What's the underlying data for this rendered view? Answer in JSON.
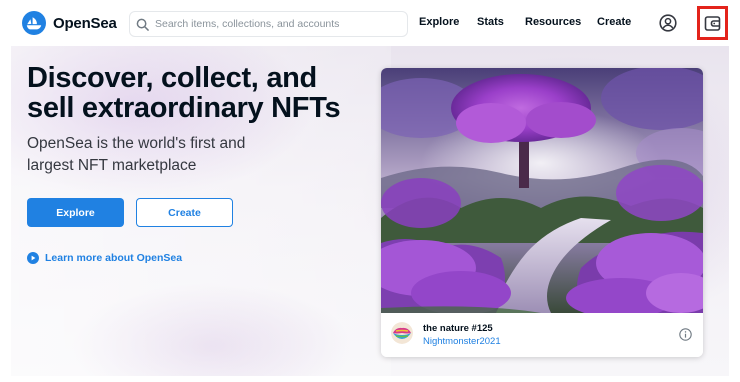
{
  "app": {
    "name": "OpenSea"
  },
  "search": {
    "placeholder": "Search items, collections, and accounts"
  },
  "nav": {
    "items": [
      {
        "label": "Explore"
      },
      {
        "label": "Stats"
      },
      {
        "label": "Resources"
      },
      {
        "label": "Create"
      }
    ]
  },
  "icons": {
    "logo": "opensea-logo-icon",
    "search": "search-icon",
    "account": "account-circle-icon",
    "wallet": "wallet-icon",
    "play": "play-circle-icon",
    "info": "info-icon"
  },
  "hero": {
    "title": "Discover, collect, and sell extraordinary NFTs",
    "subtitle": "OpenSea is the world's first and largest NFT marketplace",
    "explore_label": "Explore",
    "create_label": "Create",
    "learn_more_label": "Learn more about OpenSea"
  },
  "featured": {
    "title": "the nature #125",
    "creator": "Nightmonster2021"
  },
  "colors": {
    "brand": "#2081e2",
    "text": "#04111d",
    "highlight": "#e3231b"
  }
}
